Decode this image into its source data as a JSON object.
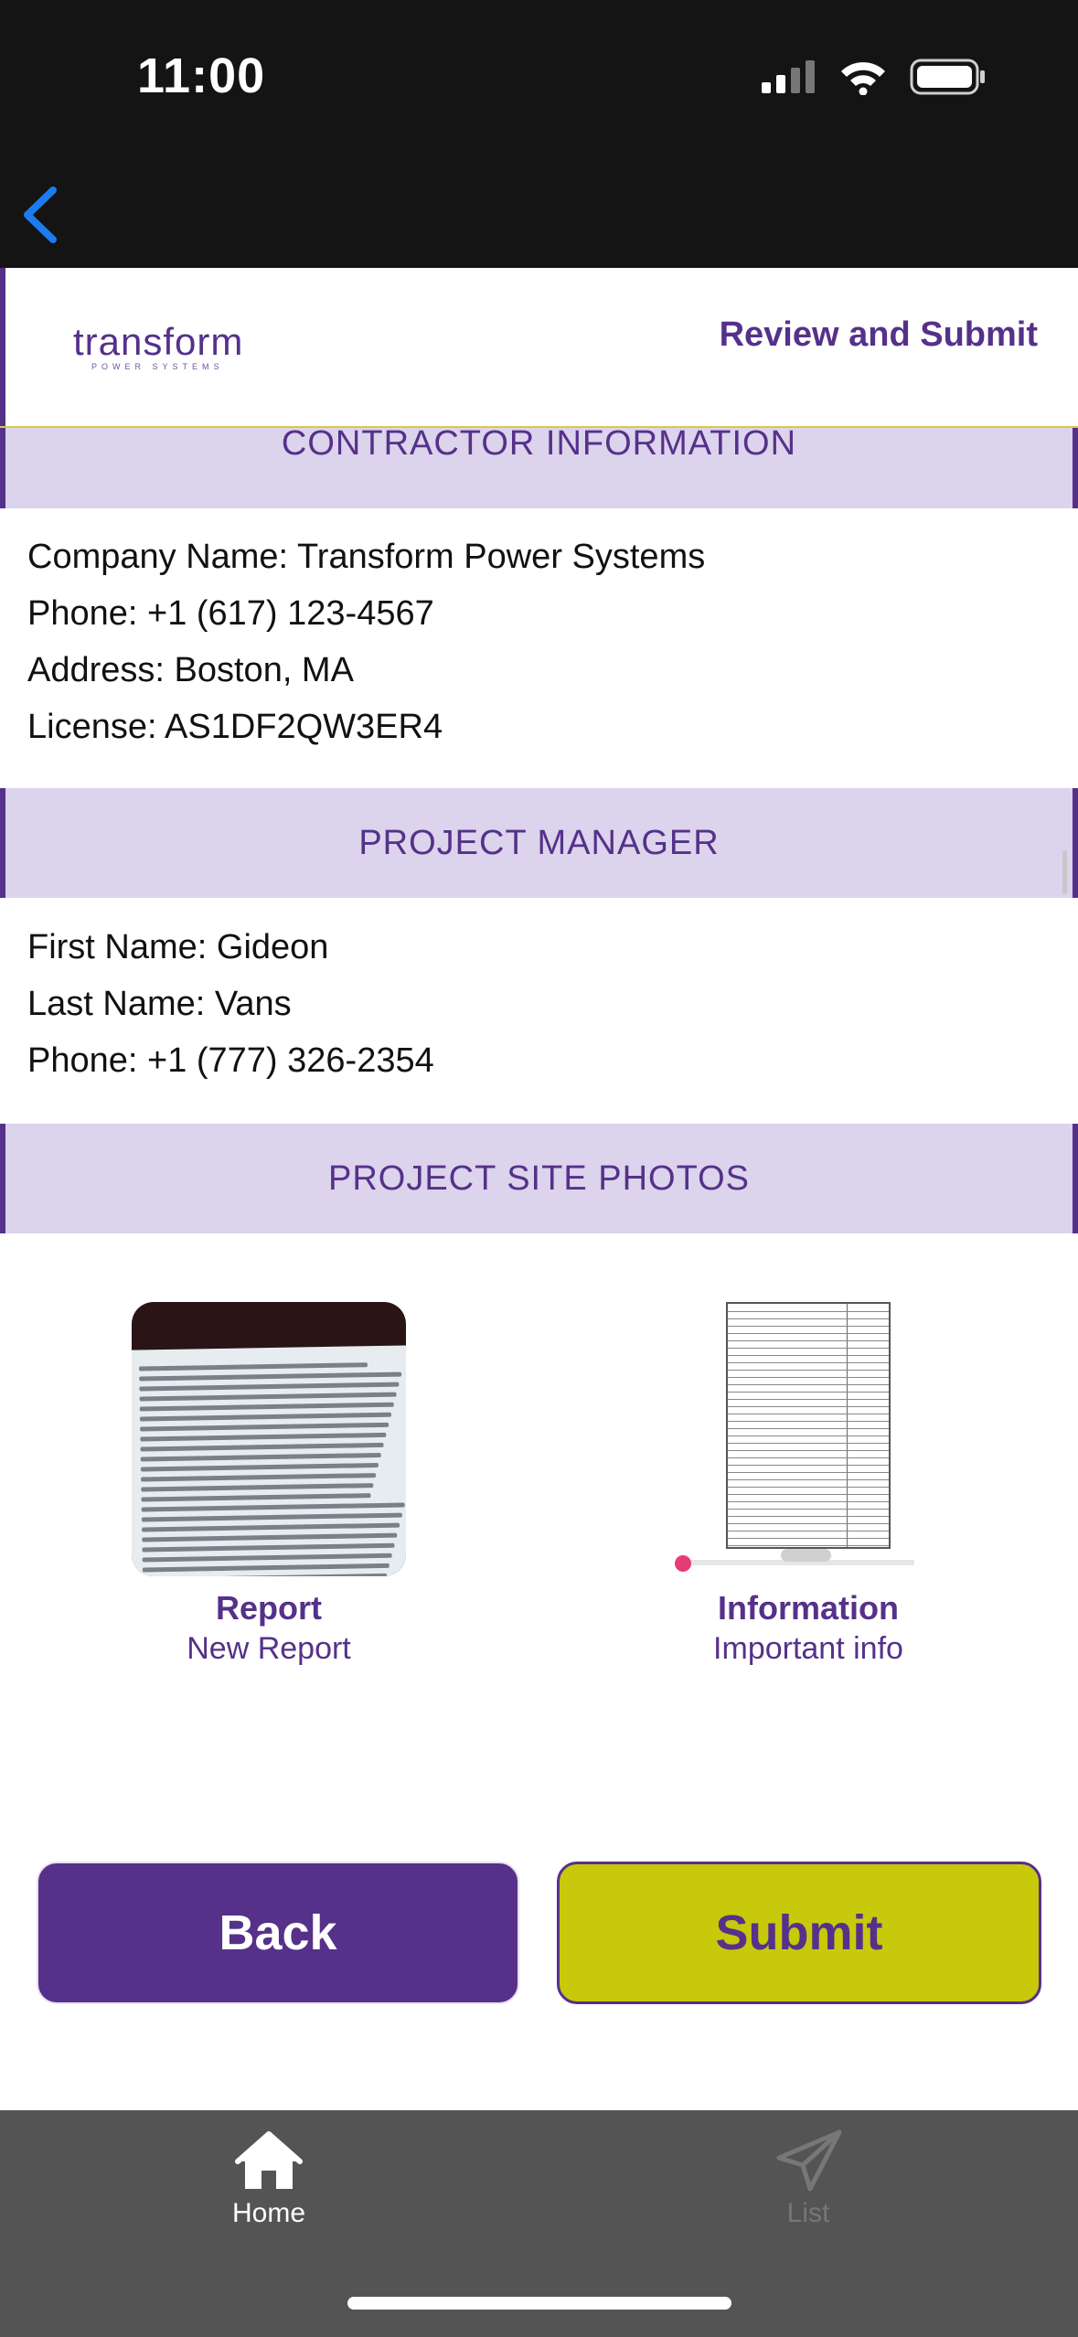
{
  "status_bar": {
    "time": "11:00"
  },
  "header": {
    "logo_text": "transform",
    "logo_subtext": "POWER SYSTEMS",
    "title": "Review and Submit"
  },
  "contractor": {
    "heading": "CONTRACTOR INFORMATION",
    "company": "Company Name: Transform Power Systems",
    "phone": "Phone: +1 (617) 123-4567",
    "address": "Address: Boston, MA",
    "license": "License: AS1DF2QW3ER4"
  },
  "project_manager": {
    "heading": "PROJECT MANAGER",
    "first_name": "First Name: Gideon",
    "last_name": "Last Name: Vans",
    "phone": "Phone: +1 (777) 326-2354"
  },
  "photos": {
    "heading": "PROJECT SITE PHOTOS",
    "items": [
      {
        "title": "Report",
        "subtitle": "New Report"
      },
      {
        "title": "Information",
        "subtitle": "Important info"
      }
    ]
  },
  "actions": {
    "back_label": "Back",
    "submit_label": "Submit"
  },
  "tabbar": {
    "items": [
      {
        "label": "Home",
        "icon": "home-icon",
        "active": true
      },
      {
        "label": "List",
        "icon": "paper-plane-icon",
        "active": false
      }
    ]
  },
  "colors": {
    "brand_purple": "#55318a",
    "accent_yellow": "#c8c90a",
    "section_bg": "#dcd3ec"
  }
}
